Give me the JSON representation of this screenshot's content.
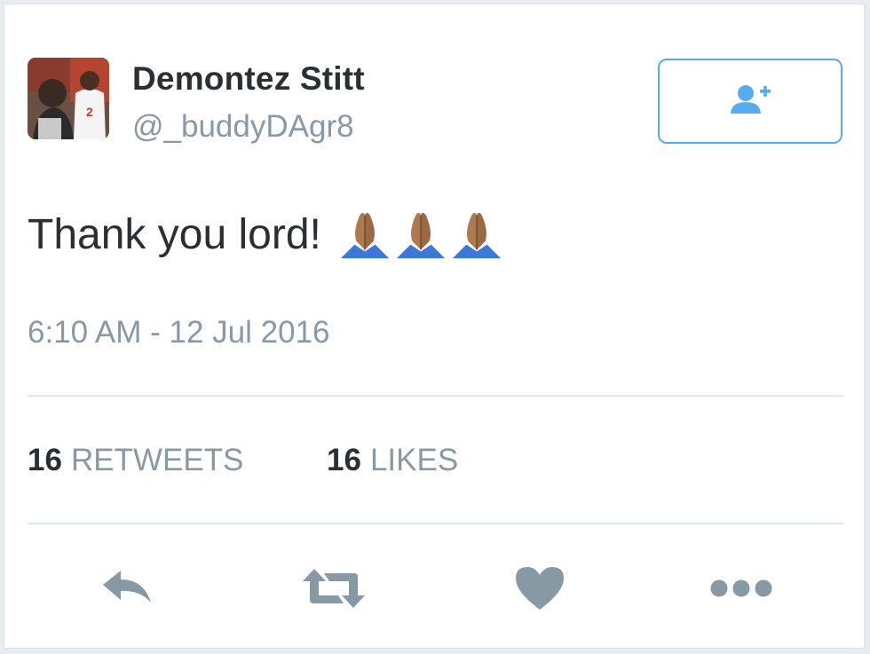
{
  "user": {
    "display_name": "Demontez Stitt",
    "handle": "@_buddyDAgr8"
  },
  "follow_button": {
    "icon": "add-user-icon",
    "accent_color": "#55acee"
  },
  "tweet": {
    "text": "Thank you lord!",
    "emoji": [
      "folded-hands-emoji",
      "folded-hands-emoji",
      "folded-hands-emoji"
    ],
    "timestamp": "6:10 AM - 12 Jul 2016"
  },
  "stats": {
    "retweets": {
      "count": "16",
      "label": "RETWEETS"
    },
    "likes": {
      "count": "16",
      "label": "LIKES"
    }
  },
  "actions": [
    {
      "name": "reply",
      "icon": "reply-icon"
    },
    {
      "name": "retweet",
      "icon": "retweet-icon"
    },
    {
      "name": "like",
      "icon": "heart-icon"
    },
    {
      "name": "more",
      "icon": "more-icon"
    }
  ],
  "colors": {
    "primary_text": "#292f33",
    "secondary_text": "#8899a6",
    "divider": "#e1e8ed",
    "action_icon": "#8899a6"
  }
}
